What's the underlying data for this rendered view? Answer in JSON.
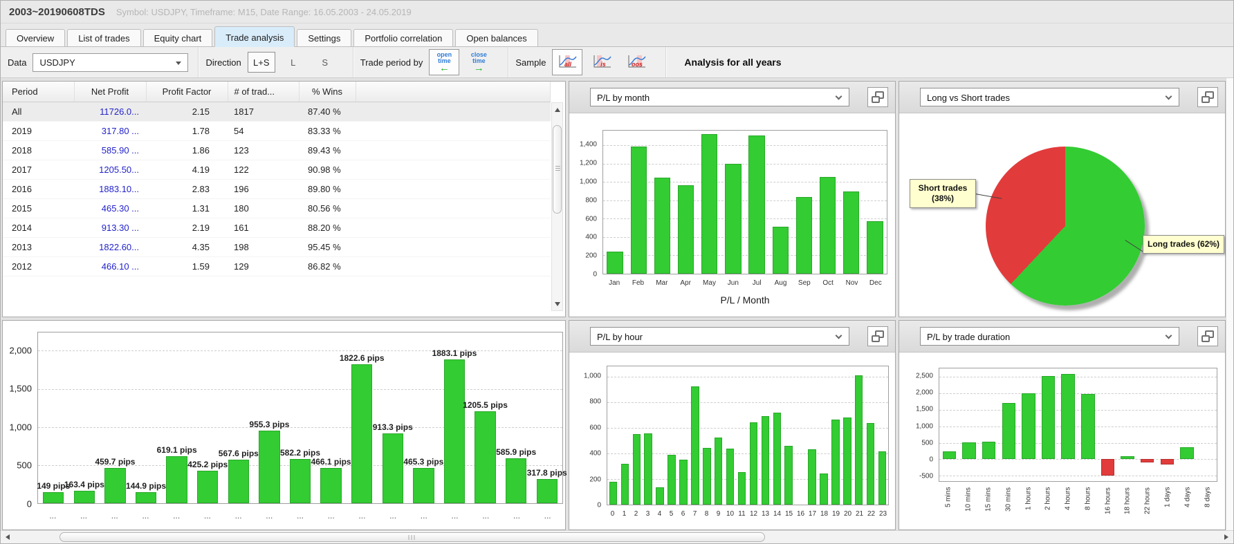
{
  "window": {
    "title": "2003~20190608TDS",
    "subtitle": "Symbol: USDJPY, Timeframe: M15, Date Range: 16.05.2003 - 24.05.2019"
  },
  "tabs": [
    {
      "label": "Overview",
      "active": false
    },
    {
      "label": "List of trades",
      "active": false
    },
    {
      "label": "Equity chart",
      "active": false
    },
    {
      "label": "Trade analysis",
      "active": true
    },
    {
      "label": "Settings",
      "active": false
    },
    {
      "label": "Portfolio correlation",
      "active": false
    },
    {
      "label": "Open balances",
      "active": false
    }
  ],
  "toolbar": {
    "data_label": "Data",
    "data_value": "USDJPY",
    "direction_label": "Direction",
    "direction_options": [
      {
        "label": "L+S",
        "selected": true
      },
      {
        "label": "L",
        "selected": false
      },
      {
        "label": "S",
        "selected": false
      }
    ],
    "trade_period_label": "Trade period by",
    "open_time_lines": [
      "open",
      "time"
    ],
    "close_time_lines": [
      "close",
      "time"
    ],
    "sample_label": "Sample",
    "sample_options": [
      {
        "label": "all",
        "selected": true
      },
      {
        "label": "is",
        "selected": false
      },
      {
        "label": "oos",
        "selected": false
      }
    ],
    "analysis_title": "Analysis for all years"
  },
  "table": {
    "columns": [
      "Period",
      "Net Profit",
      "Profit Factor",
      "# of trad...",
      "% Wins"
    ],
    "rows": [
      {
        "period": "All",
        "net_profit": "11726.0...",
        "profit_factor": "2.15",
        "trades": "1817",
        "wins": "87.40 %",
        "selected": true
      },
      {
        "period": "2019",
        "net_profit": "317.80 ...",
        "profit_factor": "1.78",
        "trades": "54",
        "wins": "83.33 %",
        "selected": false
      },
      {
        "period": "2018",
        "net_profit": "585.90 ...",
        "profit_factor": "1.86",
        "trades": "123",
        "wins": "89.43 %",
        "selected": false
      },
      {
        "period": "2017",
        "net_profit": "1205.50...",
        "profit_factor": "4.19",
        "trades": "122",
        "wins": "90.98 %",
        "selected": false
      },
      {
        "period": "2016",
        "net_profit": "1883.10...",
        "profit_factor": "2.83",
        "trades": "196",
        "wins": "89.80 %",
        "selected": false
      },
      {
        "period": "2015",
        "net_profit": "465.30 ...",
        "profit_factor": "1.31",
        "trades": "180",
        "wins": "80.56 %",
        "selected": false
      },
      {
        "period": "2014",
        "net_profit": "913.30 ...",
        "profit_factor": "2.19",
        "trades": "161",
        "wins": "88.20 %",
        "selected": false
      },
      {
        "period": "2013",
        "net_profit": "1822.60...",
        "profit_factor": "4.35",
        "trades": "198",
        "wins": "95.45 %",
        "selected": false
      },
      {
        "period": "2012",
        "net_profit": "466.10 ...",
        "profit_factor": "1.59",
        "trades": "129",
        "wins": "86.82 %",
        "selected": false
      }
    ]
  },
  "colors": {
    "bar_green": "#33cc33",
    "bar_red": "#e23b3b",
    "profit_blue": "#2222cc",
    "selected_tab": "#d8ecfa"
  },
  "chart_data": [
    {
      "id": "pl_by_month",
      "type": "bar",
      "dropdown_label": "P/L by month",
      "xlabel": "P/L / Month",
      "categories": [
        "Jan",
        "Feb",
        "Mar",
        "Apr",
        "May",
        "Jun",
        "Jul",
        "Aug",
        "Sep",
        "Oct",
        "Nov",
        "Dec"
      ],
      "values": [
        240,
        1390,
        1050,
        965,
        1520,
        1200,
        1510,
        510,
        840,
        1055,
        895,
        570
      ],
      "ylim": [
        0,
        1560
      ],
      "grid": true,
      "yticks": [
        {
          "value": 0,
          "label": "0"
        },
        {
          "value": 200,
          "label": "200"
        },
        {
          "value": 400,
          "label": "400"
        },
        {
          "value": 600,
          "label": "600"
        },
        {
          "value": 800,
          "label": "800"
        },
        {
          "value": 1000,
          "label": "1,000"
        },
        {
          "value": 1200,
          "label": "1,200"
        },
        {
          "value": 1400,
          "label": "1,400"
        }
      ]
    },
    {
      "id": "long_vs_short",
      "type": "pie",
      "dropdown_label": "Long vs Short trades",
      "slices": [
        {
          "label": "Long trades (62%)",
          "value": 62,
          "color": "#33cc33"
        },
        {
          "label": "Short trades (38%)",
          "value": 38,
          "color": "#e23b3b"
        }
      ]
    },
    {
      "id": "pl_by_year",
      "type": "bar",
      "categories": [
        "...",
        "...",
        "...",
        "...",
        "...",
        "...",
        "...",
        "...",
        "...",
        "...",
        "...",
        "...",
        "...",
        "...",
        "...",
        "...",
        "..."
      ],
      "values": [
        149,
        163.4,
        459.7,
        144.9,
        619.1,
        425.2,
        567.6,
        955.3,
        582.2,
        466.1,
        1822.6,
        913.3,
        465.3,
        1883.1,
        1205.5,
        585.9,
        317.8
      ],
      "value_labels": [
        "149 pips",
        "163.4 pips",
        "459.7 pips",
        "144.9 pips",
        "619.1 pips",
        "425.2 pips",
        "567.6 pips",
        "955.3 pips",
        "582.2 pips",
        "466.1 pips",
        "1822.6 pips",
        "913.3 pips",
        "465.3 pips",
        "1883.1 pips",
        "1205.5 pips",
        "585.9 pips",
        "317.8 pips"
      ],
      "ylim": [
        0,
        2240
      ],
      "grid": true,
      "yticks": [
        {
          "value": 0,
          "label": "0"
        },
        {
          "value": 500,
          "label": "500"
        },
        {
          "value": 1000,
          "label": "1,000"
        },
        {
          "value": 1500,
          "label": "1,500"
        },
        {
          "value": 2000,
          "label": "2,000"
        }
      ]
    },
    {
      "id": "pl_by_hour",
      "type": "bar",
      "dropdown_label": "P/L by hour",
      "categories": [
        "0",
        "1",
        "2",
        "3",
        "4",
        "5",
        "6",
        "7",
        "8",
        "9",
        "10",
        "11",
        "12",
        "13",
        "14",
        "15",
        "16",
        "17",
        "18",
        "19",
        "20",
        "21",
        "22",
        "23"
      ],
      "values": [
        180,
        320,
        550,
        555,
        135,
        390,
        350,
        925,
        445,
        525,
        435,
        255,
        640,
        690,
        720,
        460,
        0,
        430,
        245,
        665,
        680,
        1010,
        635,
        415
      ],
      "ylim": [
        0,
        1080
      ],
      "grid": true,
      "yticks": [
        {
          "value": 0,
          "label": "0"
        },
        {
          "value": 200,
          "label": "200"
        },
        {
          "value": 400,
          "label": "400"
        },
        {
          "value": 600,
          "label": "600"
        },
        {
          "value": 800,
          "label": "800"
        },
        {
          "value": 1000,
          "label": "1,000"
        }
      ]
    },
    {
      "id": "pl_by_duration",
      "type": "bar",
      "dropdown_label": "P/L by trade duration",
      "rotate_xlabels": true,
      "categories": [
        "5 mins",
        "10 mins",
        "15 mins",
        "30 mins",
        "1 hours",
        "2 hours",
        "4 hours",
        "8 hours",
        "16 hours",
        "18 hours",
        "22 hours",
        "1 days",
        "4 days",
        "8 days"
      ],
      "values": [
        230,
        510,
        530,
        1700,
        2000,
        2510,
        2580,
        1980,
        -490,
        100,
        -90,
        -160,
        370,
        0
      ],
      "ylim": [
        -660,
        2750
      ],
      "grid": true,
      "yticks": [
        {
          "value": -500,
          "label": "-500"
        },
        {
          "value": 0,
          "label": "0"
        },
        {
          "value": 500,
          "label": "500"
        },
        {
          "value": 1000,
          "label": "1,000"
        },
        {
          "value": 1500,
          "label": "1,500"
        },
        {
          "value": 2000,
          "label": "2,000"
        },
        {
          "value": 2500,
          "label": "2,500"
        }
      ]
    }
  ]
}
